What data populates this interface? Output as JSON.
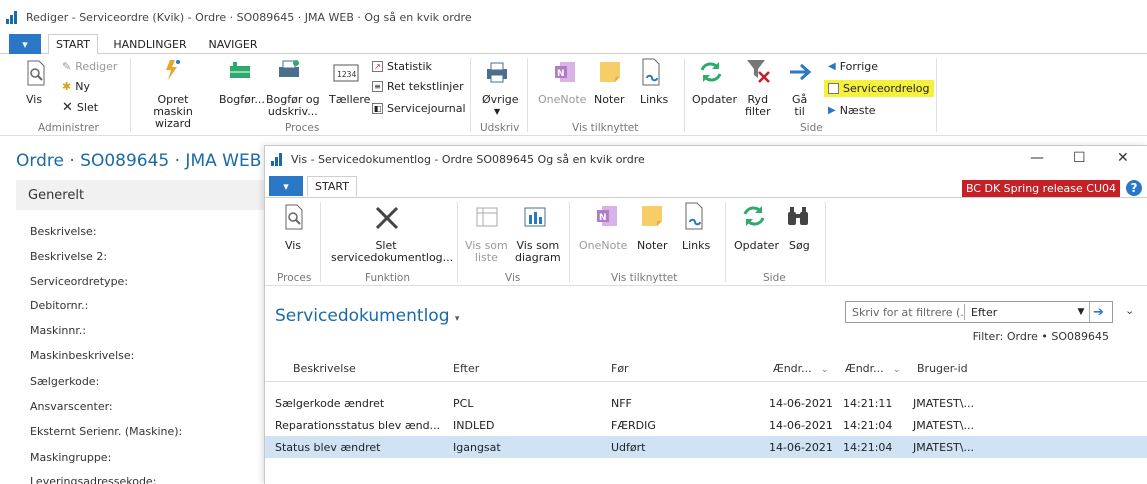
{
  "window": {
    "title": "Rediger - Serviceordre (Kvik) - Ordre · SO089645 · JMA WEB · Og så en kvik ordre"
  },
  "tabs": {
    "file": "▾",
    "items": [
      "START",
      "HANDLINGER",
      "NAVIGER"
    ]
  },
  "ribbon": {
    "vis": "Vis",
    "rediger": "Rediger",
    "ny": "Ny",
    "slet": "Slet",
    "grp_admin": "Administrer",
    "opret": "Opret maskin\nwizard",
    "bogfor": "Bogfør...",
    "bogfor_udskriv": "Bogfør og\nudskriv...",
    "taellere": "Tællere",
    "statistik": "Statistik",
    "ret_tekst": "Ret tekstlinjer",
    "servicejournal": "Servicejournal",
    "grp_proces": "Proces",
    "ovrige": "Øvrige",
    "grp_udskriv": "Udskriv",
    "onenote": "OneNote",
    "noter": "Noter",
    "links": "Links",
    "grp_vis_tilknyttet": "Vis tilknyttet",
    "opdater": "Opdater",
    "ryd_filter": "Ryd\nfilter",
    "ga_til": "Gå\ntil",
    "forrige": "Forrige",
    "serviceordrelog": "Serviceordrelog",
    "naeste": "Næste",
    "grp_side": "Side"
  },
  "form": {
    "title": "Ordre · SO089645 · JMA WEB · (",
    "section": "Generelt",
    "fields": [
      "Beskrivelse:",
      "Beskrivelse 2:",
      "Serviceordretype:",
      "Debitornr.:",
      "Maskinnr.:",
      "Maskinbeskrivelse:",
      "Sælgerkode:",
      "Ansvarscenter:",
      "Eksternt Serienr. (Maskine):",
      "Maskingruppe:",
      "Leveringsadressekode:"
    ]
  },
  "dialog": {
    "title": "Vis - Servicedokumentlog - Ordre SO089645 Og så en kvik ordre",
    "tab": "START",
    "badge": "BC DK Spring release CU04",
    "help": "?",
    "ribbon": {
      "vis": "Vis",
      "grp_proces": "Proces",
      "slet": "Slet\nservicedokumentlog...",
      "grp_funktion": "Funktion",
      "vis_liste": "Vis som\nliste",
      "vis_diagram": "Vis som\ndiagram",
      "grp_vis": "Vis",
      "onenote": "OneNote",
      "noter": "Noter",
      "links": "Links",
      "grp_vis_tilknyttet": "Vis tilknyttet",
      "opdater": "Opdater",
      "sog": "Søg",
      "grp_side": "Side"
    },
    "list_title": "Servicedokumentlog",
    "filter": {
      "placeholder": "Skriv for at filtrere (...",
      "field": "Efter"
    },
    "filter_text": "Filter: Ordre • SO089645",
    "columns": [
      "Beskrivelse",
      "Efter",
      "Før",
      "Ændr...",
      "Ændr...",
      "Bruger-id"
    ],
    "rows": [
      [
        "Sælgerkode ændret",
        "PCL",
        "NFF",
        "14-06-2021",
        "14:21:11",
        "JMATEST\\..."
      ],
      [
        "Reparationsstatus blev ænd...",
        "INDLED",
        "FÆRDIG",
        "14-06-2021",
        "14:21:04",
        "JMATEST\\..."
      ],
      [
        "Status blev ændret",
        "Igangsat",
        "Udført",
        "14-06-2021",
        "14:21:04",
        "JMATEST\\..."
      ]
    ],
    "selected_row": 2
  },
  "colors": {
    "accent": "#1a6aa8",
    "badge": "#c62027",
    "highlight": "#f5f03a",
    "selected": "#cfe3f5"
  }
}
